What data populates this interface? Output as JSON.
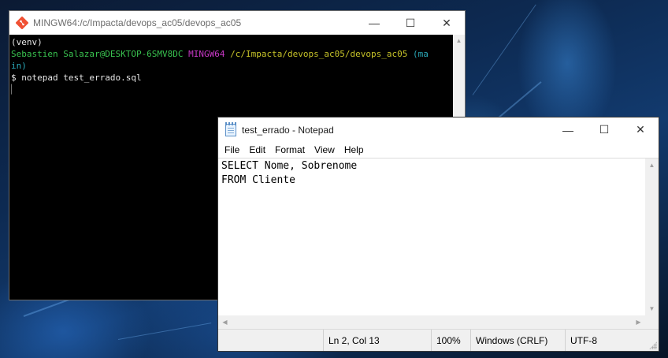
{
  "terminal": {
    "title": "MINGW64:/c/Impacta/devops_ac05/devops_ac05",
    "controls": {
      "minimize": "—",
      "maximize": "☐",
      "close": "✕"
    },
    "lines": {
      "venv": "(venv)",
      "user_host": "Sebastien Salazar@DESKTOP-6SMV8DC",
      "system": "MINGW64",
      "path": "/c/Impacta/devops_ac05/devops_ac05",
      "branch_part1": "(ma",
      "branch_part2": "in)",
      "prompt": "$",
      "command": "notepad test_errado.sql"
    }
  },
  "notepad": {
    "title": "test_errado - Notepad",
    "controls": {
      "minimize": "—",
      "maximize": "☐",
      "close": "✕"
    },
    "menu": [
      "File",
      "Edit",
      "Format",
      "View",
      "Help"
    ],
    "content": "SELECT Nome, Sobrenome\nFROM Cliente",
    "status": {
      "position": "Ln 2, Col 13",
      "zoom": "100%",
      "line_ending": "Windows (CRLF)",
      "encoding": "UTF-8"
    }
  }
}
